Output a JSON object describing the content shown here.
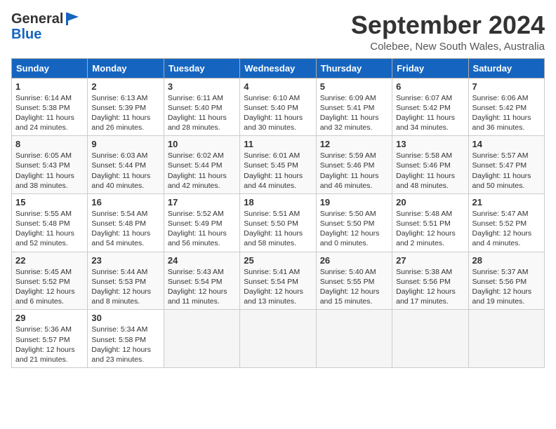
{
  "header": {
    "logo_general": "General",
    "logo_blue": "Blue",
    "month_title": "September 2024",
    "location": "Colebee, New South Wales, Australia"
  },
  "days_of_week": [
    "Sunday",
    "Monday",
    "Tuesday",
    "Wednesday",
    "Thursday",
    "Friday",
    "Saturday"
  ],
  "weeks": [
    [
      {
        "day": "1",
        "sunrise": "6:14 AM",
        "sunset": "5:38 PM",
        "daylight": "11 hours and 24 minutes."
      },
      {
        "day": "2",
        "sunrise": "6:13 AM",
        "sunset": "5:39 PM",
        "daylight": "11 hours and 26 minutes."
      },
      {
        "day": "3",
        "sunrise": "6:11 AM",
        "sunset": "5:40 PM",
        "daylight": "11 hours and 28 minutes."
      },
      {
        "day": "4",
        "sunrise": "6:10 AM",
        "sunset": "5:40 PM",
        "daylight": "11 hours and 30 minutes."
      },
      {
        "day": "5",
        "sunrise": "6:09 AM",
        "sunset": "5:41 PM",
        "daylight": "11 hours and 32 minutes."
      },
      {
        "day": "6",
        "sunrise": "6:07 AM",
        "sunset": "5:42 PM",
        "daylight": "11 hours and 34 minutes."
      },
      {
        "day": "7",
        "sunrise": "6:06 AM",
        "sunset": "5:42 PM",
        "daylight": "11 hours and 36 minutes."
      }
    ],
    [
      {
        "day": "8",
        "sunrise": "6:05 AM",
        "sunset": "5:43 PM",
        "daylight": "11 hours and 38 minutes."
      },
      {
        "day": "9",
        "sunrise": "6:03 AM",
        "sunset": "5:44 PM",
        "daylight": "11 hours and 40 minutes."
      },
      {
        "day": "10",
        "sunrise": "6:02 AM",
        "sunset": "5:44 PM",
        "daylight": "11 hours and 42 minutes."
      },
      {
        "day": "11",
        "sunrise": "6:01 AM",
        "sunset": "5:45 PM",
        "daylight": "11 hours and 44 minutes."
      },
      {
        "day": "12",
        "sunrise": "5:59 AM",
        "sunset": "5:46 PM",
        "daylight": "11 hours and 46 minutes."
      },
      {
        "day": "13",
        "sunrise": "5:58 AM",
        "sunset": "5:46 PM",
        "daylight": "11 hours and 48 minutes."
      },
      {
        "day": "14",
        "sunrise": "5:57 AM",
        "sunset": "5:47 PM",
        "daylight": "11 hours and 50 minutes."
      }
    ],
    [
      {
        "day": "15",
        "sunrise": "5:55 AM",
        "sunset": "5:48 PM",
        "daylight": "11 hours and 52 minutes."
      },
      {
        "day": "16",
        "sunrise": "5:54 AM",
        "sunset": "5:48 PM",
        "daylight": "11 hours and 54 minutes."
      },
      {
        "day": "17",
        "sunrise": "5:52 AM",
        "sunset": "5:49 PM",
        "daylight": "11 hours and 56 minutes."
      },
      {
        "day": "18",
        "sunrise": "5:51 AM",
        "sunset": "5:50 PM",
        "daylight": "11 hours and 58 minutes."
      },
      {
        "day": "19",
        "sunrise": "5:50 AM",
        "sunset": "5:50 PM",
        "daylight": "12 hours and 0 minutes."
      },
      {
        "day": "20",
        "sunrise": "5:48 AM",
        "sunset": "5:51 PM",
        "daylight": "12 hours and 2 minutes."
      },
      {
        "day": "21",
        "sunrise": "5:47 AM",
        "sunset": "5:52 PM",
        "daylight": "12 hours and 4 minutes."
      }
    ],
    [
      {
        "day": "22",
        "sunrise": "5:45 AM",
        "sunset": "5:52 PM",
        "daylight": "12 hours and 6 minutes."
      },
      {
        "day": "23",
        "sunrise": "5:44 AM",
        "sunset": "5:53 PM",
        "daylight": "12 hours and 8 minutes."
      },
      {
        "day": "24",
        "sunrise": "5:43 AM",
        "sunset": "5:54 PM",
        "daylight": "12 hours and 11 minutes."
      },
      {
        "day": "25",
        "sunrise": "5:41 AM",
        "sunset": "5:54 PM",
        "daylight": "12 hours and 13 minutes."
      },
      {
        "day": "26",
        "sunrise": "5:40 AM",
        "sunset": "5:55 PM",
        "daylight": "12 hours and 15 minutes."
      },
      {
        "day": "27",
        "sunrise": "5:38 AM",
        "sunset": "5:56 PM",
        "daylight": "12 hours and 17 minutes."
      },
      {
        "day": "28",
        "sunrise": "5:37 AM",
        "sunset": "5:56 PM",
        "daylight": "12 hours and 19 minutes."
      }
    ],
    [
      {
        "day": "29",
        "sunrise": "5:36 AM",
        "sunset": "5:57 PM",
        "daylight": "12 hours and 21 minutes."
      },
      {
        "day": "30",
        "sunrise": "5:34 AM",
        "sunset": "5:58 PM",
        "daylight": "12 hours and 23 minutes."
      },
      null,
      null,
      null,
      null,
      null
    ]
  ]
}
